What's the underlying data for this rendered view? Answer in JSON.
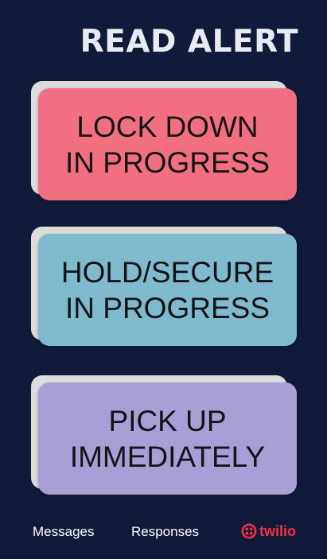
{
  "header": {
    "title": "READ ALERT"
  },
  "alerts": [
    {
      "line1": "LOCK DOWN",
      "line2": "IN PROGRESS",
      "color": "#f26f82"
    },
    {
      "line1": "HOLD/SECURE",
      "line2": "IN PROGRESS",
      "color": "#7fbacd"
    },
    {
      "line1": "PICK UP",
      "line2": "IMMEDIATELY",
      "color": "#a99ed6"
    }
  ],
  "footer": {
    "messages_label": "Messages",
    "responses_label": "Responses",
    "brand_name": "twilio",
    "brand_icon": "twilio-logo-icon",
    "brand_color": "#f22f46"
  },
  "colors": {
    "background": "#121a3a",
    "card_back": "#dcdcdc"
  }
}
